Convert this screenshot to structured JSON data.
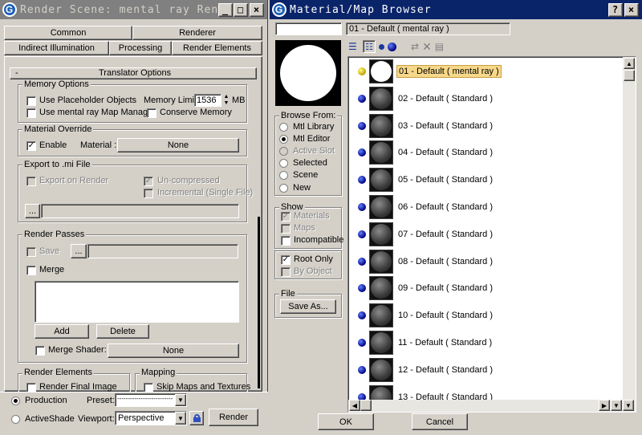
{
  "render_scene": {
    "title": "Render Scene: mental ray Rend",
    "tabs_top": [
      "Common",
      "Renderer"
    ],
    "tabs_bottom": [
      "Indirect Illumination",
      "Processing",
      "Render Elements"
    ],
    "rollout_title": "Translator Options",
    "rollout_toggle": "-",
    "memory_options": {
      "title": "Memory Options",
      "use_placeholder": "Use Placeholder Objects",
      "memory_limit_label": "Memory Limit:",
      "memory_limit_value": "1536",
      "memory_unit": "MB",
      "use_map_manager": "Use mental ray Map Manager",
      "conserve_memory": "Conserve Memory"
    },
    "material_override": {
      "title": "Material Override",
      "enable": "Enable",
      "material_label": "Material :",
      "material_value": "None"
    },
    "export_mi": {
      "title": "Export to .mi File",
      "export_on_render": "Export on Render",
      "uncompressed": "Un-compressed",
      "incremental": "Incremental (Single File)",
      "browse": "..."
    },
    "render_passes": {
      "title": "Render Passes",
      "save": "Save",
      "browse": "...",
      "merge": "Merge",
      "add": "Add",
      "delete": "Delete",
      "merge_shader": "Merge Shader:",
      "merge_shader_value": "None"
    },
    "render_elements": {
      "title": "Render Elements",
      "render_final_image": "Render Final Image"
    },
    "mapping": {
      "title": "Mapping",
      "skip_maps": "Skip Maps and Textures"
    },
    "footer": {
      "production": "Production",
      "preset_label": "Preset:",
      "preset_value": "--------------------------",
      "activeshade": "ActiveShade",
      "viewport_label": "Viewport:",
      "viewport_value": "Perspective",
      "render_button": "Render"
    }
  },
  "browser": {
    "title": "Material/Map Browser",
    "help_btn": "?",
    "close_btn": "×",
    "current_material": "01 - Default  ( mental ray )",
    "browse_from": {
      "title": "Browse From:",
      "options": [
        "Mtl Library",
        "Mtl Editor",
        "Active Slot",
        "Selected",
        "Scene",
        "New"
      ]
    },
    "show": {
      "title": "Show",
      "materials": "Materials",
      "maps": "Maps",
      "incompatible": "Incompatible",
      "root_only": "Root Only",
      "by_object": "By Object"
    },
    "file": {
      "title": "File",
      "save_as": "Save As..."
    },
    "materials": [
      "01 - Default  ( mental ray )",
      "02 - Default  ( Standard )",
      "03 - Default  ( Standard )",
      "04 - Default  ( Standard )",
      "05 - Default  ( Standard )",
      "06 - Default  ( Standard )",
      "07 - Default  ( Standard )",
      "08 - Default  ( Standard )",
      "09 - Default  ( Standard )",
      "10 - Default  ( Standard )",
      "11 - Default  ( Standard )",
      "12 - Default  ( Standard )",
      "13 - Default  ( Standard )"
    ],
    "ok": "OK",
    "cancel": "Cancel"
  }
}
